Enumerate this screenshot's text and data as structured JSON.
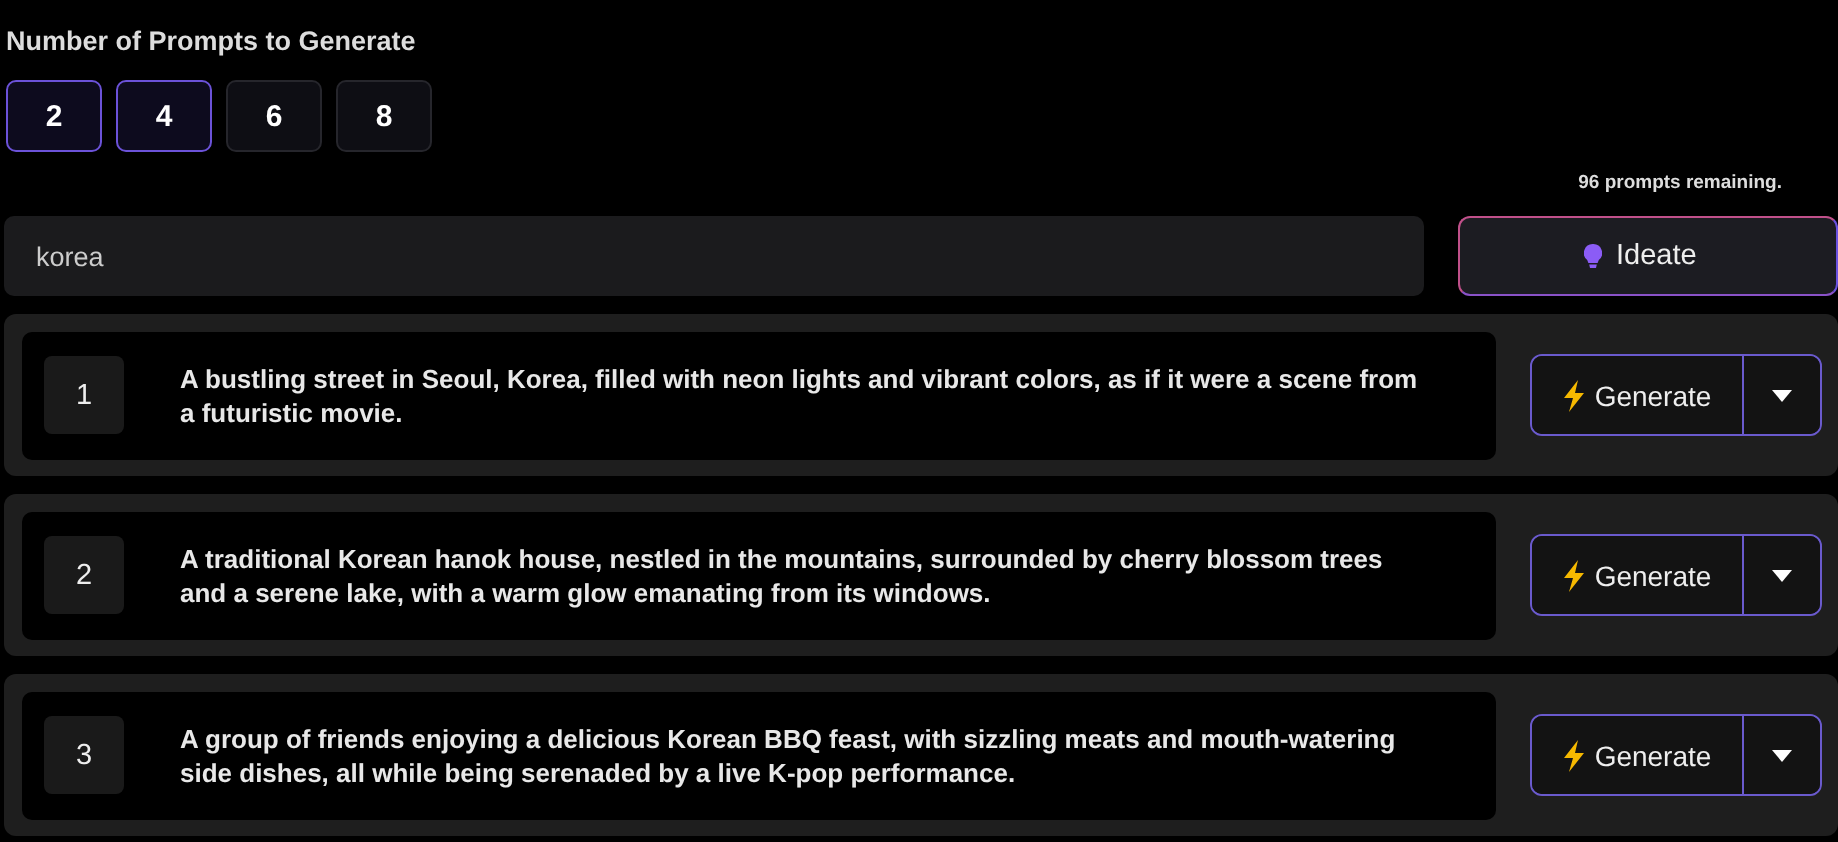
{
  "count_label": "Number of Prompts to Generate",
  "count_options": [
    {
      "label": "2",
      "selected": true
    },
    {
      "label": "4",
      "selected": true
    },
    {
      "label": "6",
      "selected": false
    },
    {
      "label": "8",
      "selected": false
    }
  ],
  "remaining": "96 prompts remaining.",
  "topic_field": {
    "value": "korea"
  },
  "ideate_button": "Ideate",
  "prompts": [
    {
      "number": "1",
      "text": "A bustling street in Seoul, Korea, filled with neon lights and vibrant colors, as if it were a scene from a futuristic movie.",
      "button": "Generate"
    },
    {
      "number": "2",
      "text": "A traditional Korean hanok house, nestled in the mountains, surrounded by cherry blossom trees and a serene lake, with a warm glow emanating from its windows.",
      "button": "Generate"
    },
    {
      "number": "3",
      "text": "A group of friends enjoying a delicious Korean BBQ feast, with sizzling meats and mouth-watering side dishes, all while being serenaded by a live K-pop performance.",
      "button": "Generate"
    }
  ]
}
